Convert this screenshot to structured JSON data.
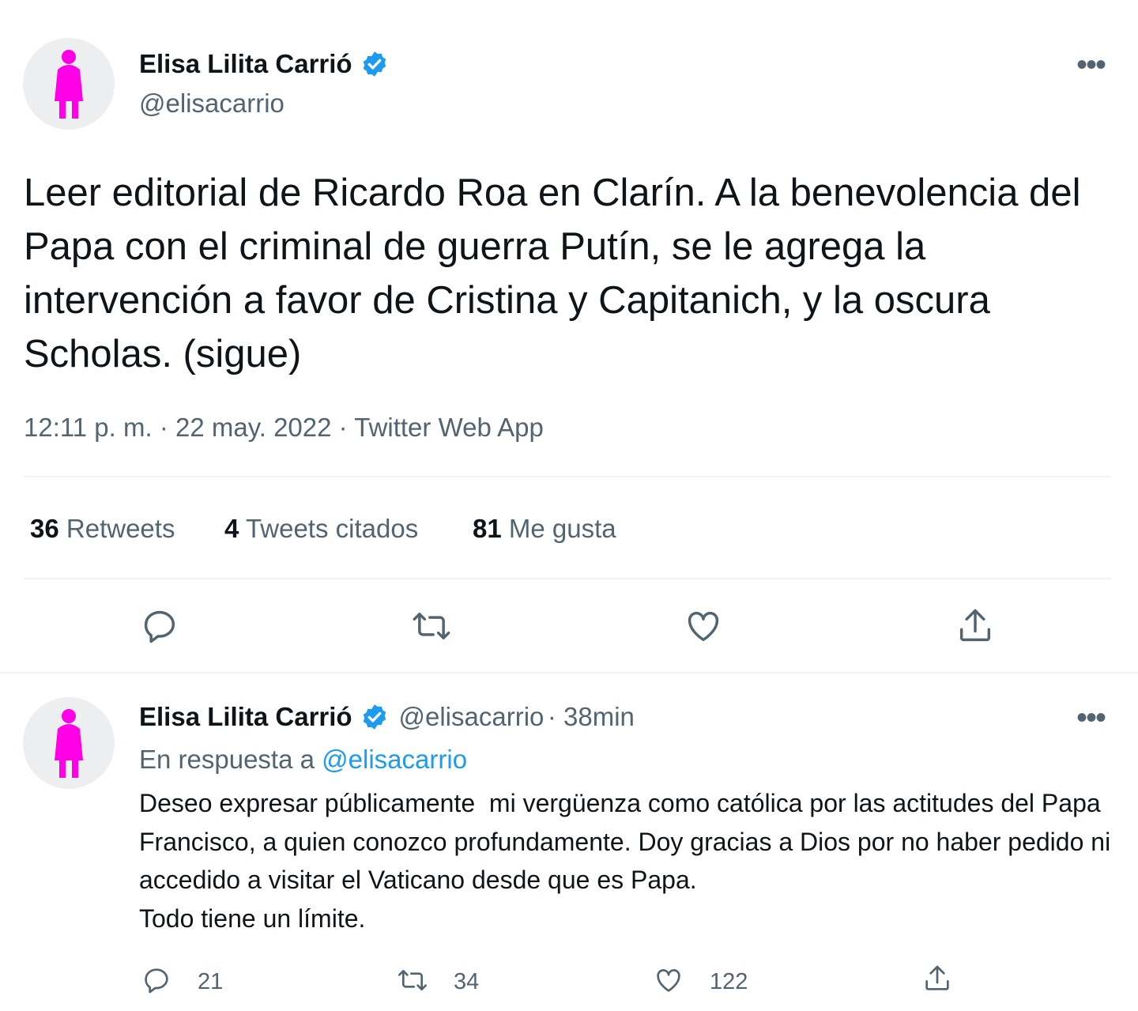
{
  "tweet": {
    "author_name": "Elisa Lilita Carrió",
    "author_handle": "@elisacarrio",
    "more_label": "•••",
    "text": "Leer editorial de Ricardo Roa en Clarín. A la benevolencia del Papa con el criminal de guerra Putín, se le agrega la intervención a favor de Cristina y Capitanich, y la oscura Scholas. (sigue)",
    "meta": "12:11 p. m. · 22 may. 2022 · Twitter Web App",
    "stats": {
      "retweets_count": "36",
      "retweets_label": "Retweets",
      "quotes_count": "4",
      "quotes_label": "Tweets citados",
      "likes_count": "81",
      "likes_label": "Me gusta"
    },
    "actions": [
      "reply-icon",
      "retweet-icon",
      "like-icon",
      "share-icon"
    ]
  },
  "reply": {
    "author_name": "Elisa Lilita Carrió",
    "author_handle": "@elisacarrio",
    "time": "· 38min",
    "more_label": "•••",
    "replying_prefix": "En respuesta a ",
    "replying_mention": "@elisacarrio",
    "text": "Deseo expresar públicamente  mi vergüenza como católica por las actitudes del Papa Francisco, a quien conozco profundamente. Doy gracias a Dios por no haber pedido ni accedido a visitar el Vaticano desde que es Papa.\nTodo tiene un límite.",
    "counts": {
      "reply": "21",
      "retweet": "34",
      "like": "122"
    }
  },
  "colors": {
    "accent": "#1d9bf0",
    "avatar_figure": "#ff00e6",
    "secondary_text": "#536471"
  }
}
